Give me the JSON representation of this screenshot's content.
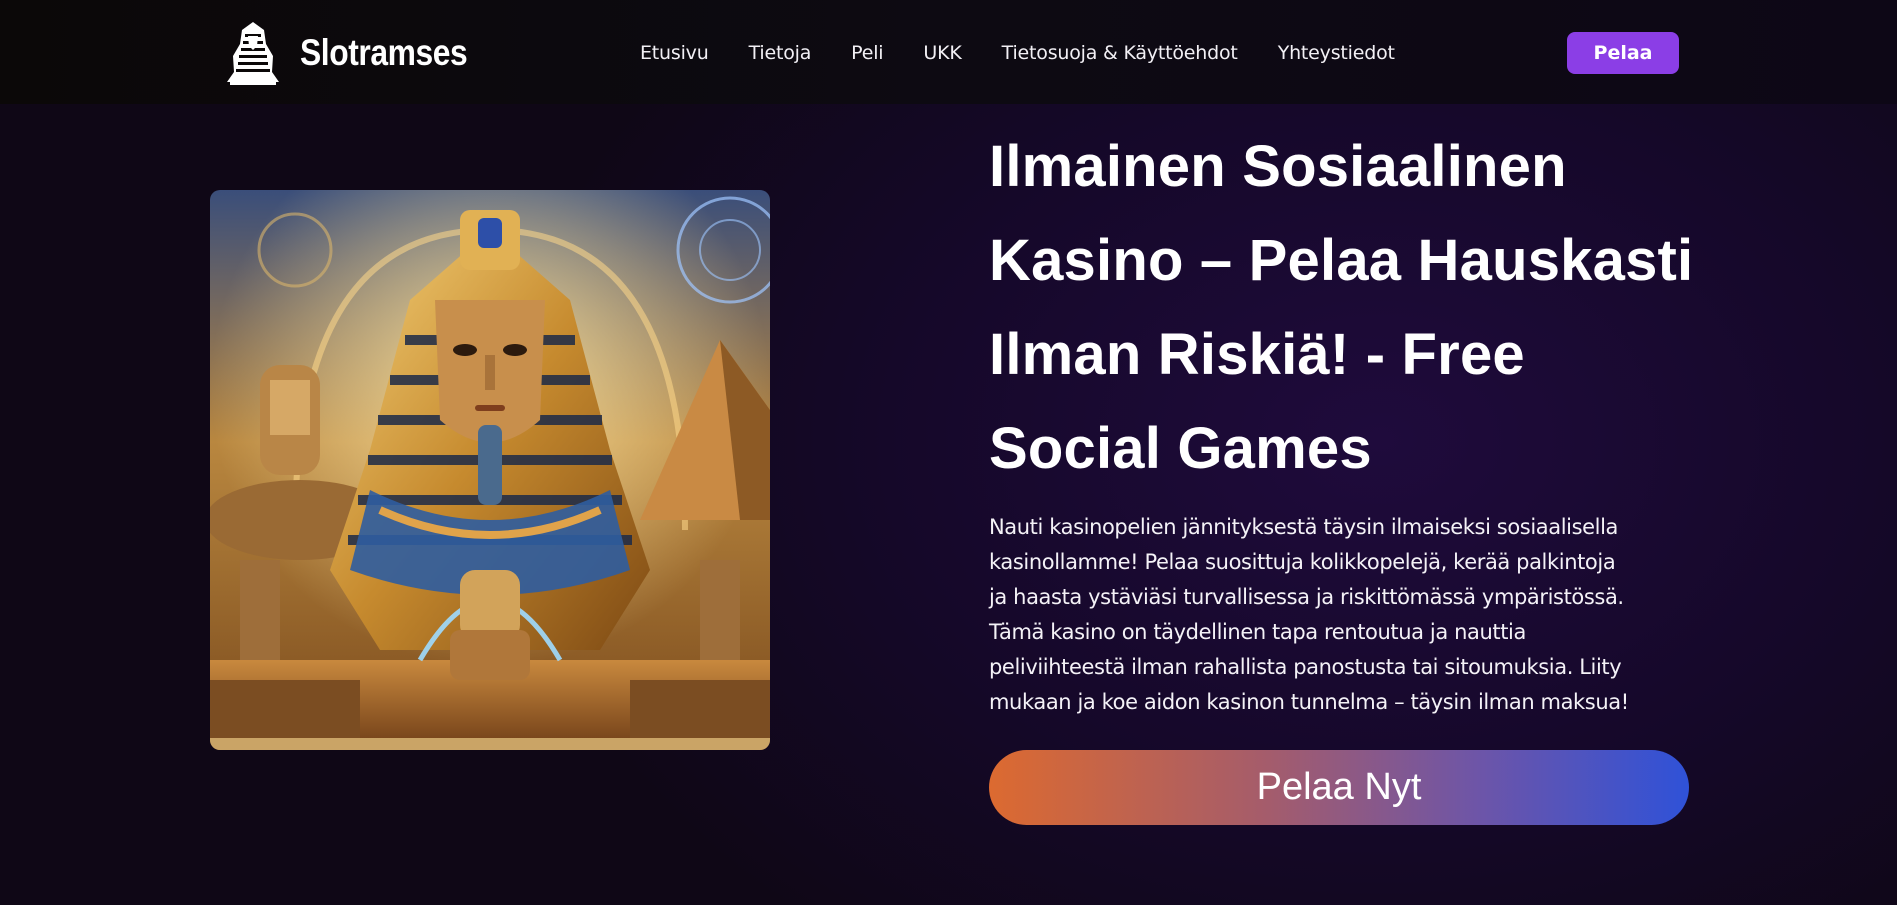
{
  "brand": {
    "name": "Slotramses",
    "logo_icon": "sphinx-logo-icon"
  },
  "nav": {
    "items": [
      {
        "label": "Etusivu"
      },
      {
        "label": "Tietoja"
      },
      {
        "label": "Peli"
      },
      {
        "label": "UKK"
      },
      {
        "label": "Tietosuoja & Käyttöehdot"
      },
      {
        "label": "Yhteystiedot"
      }
    ],
    "play_label": "Pelaa"
  },
  "hero": {
    "image_icon": "pharaoh-illustration",
    "title": "Ilmainen Sosiaalinen Kasino – Pelaa Hauskasti Ilman Riskiä! - Free Social Games",
    "description": "Nauti kasinopelien jännityksestä täysin ilmaiseksi sosiaalisella kasinollamme! Pelaa suosittuja kolikkopelejä, kerää palkintoja ja haasta ystäviäsi turvallisessa ja riskittömässä ympäristössä. Tämä kasino on täydellinen tapa rentoutua ja nauttia peliviihteestä ilman rahallista panostusta tai sitoumuksia. Liity mukaan ja koe aidon kasinon tunnelma – täysin ilman maksua!",
    "cta_label": "Pelaa Nyt"
  },
  "colors": {
    "accent_purple": "#8b3ee6",
    "cta_start": "#dc6a30",
    "cta_end": "#2f52d8",
    "background": "#120a1a"
  }
}
